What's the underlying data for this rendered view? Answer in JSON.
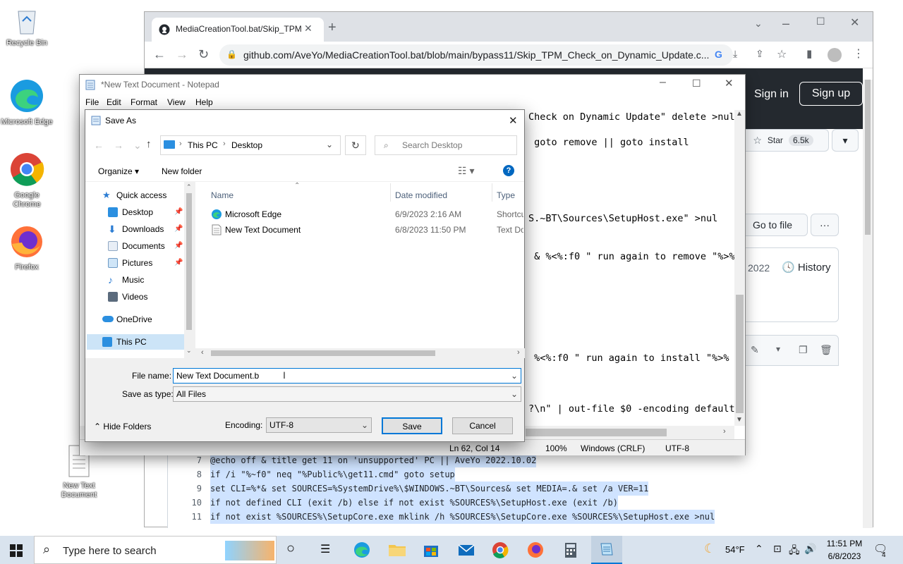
{
  "desktop": {
    "icons": [
      {
        "label": "Recycle Bin"
      },
      {
        "label": "Microsoft Edge"
      },
      {
        "label": "Google Chrome"
      },
      {
        "label": "Firefox"
      },
      {
        "label": "New Text Document"
      }
    ]
  },
  "browser": {
    "tab_title": "MediaCreationTool.bat/Skip_TPM",
    "url": "github.com/AveYo/MediaCreationTool.bat/blob/main/bypass11/Skip_TPM_Check_on_Dynamic_Update.c...",
    "signin": "Sign in",
    "signup": "Sign up",
    "star": "Star",
    "star_count": "6.5k",
    "go_to_file": "Go to file",
    "more": "···",
    "year": "2022",
    "history": "History",
    "code_lines": [
      {
        "n": "7",
        "text": "@echo off & title get 11 on 'unsupported' PC || AveYo 2022.10.02"
      },
      {
        "n": "8",
        "text": "if /i \"%~f0\" neq \"%Public%\\get11.cmd\" goto setup"
      },
      {
        "n": "9",
        "text": "set CLI=%*& set SOURCES=%SystemDrive%\\$WINDOWS.~BT\\Sources& set MEDIA=.& set /a VER=11"
      },
      {
        "n": "10",
        "text": "if not defined CLI (exit /b) else if not exist %SOURCES%\\SetupHost.exe (exit /b)"
      },
      {
        "n": "11",
        "text": "if not exist %SOURCES%\\SetupCore.exe mklink /h %SOURCES%\\SetupCore.exe %SOURCES%\\SetupHost.exe >nul"
      }
    ]
  },
  "notepad": {
    "title": "*New Text Document - Notepad",
    "menu": [
      "File",
      "Edit",
      "Format",
      "View",
      "Help"
    ],
    "visible_lines": [
      "Check on Dynamic Update\" delete >nul",
      " goto remove || goto install",
      "S.~BT\\Sources\\SetupHost.exe\" >nul",
      " & %<%:f0 \" run again to remove \"%>%",
      " %<%:f0 \" run again to install \"%>%",
      "?\\n\" | out-file $0 -encoding default"
    ],
    "status": {
      "position": "Ln 62, Col 14",
      "zoom": "100%",
      "eol": "Windows (CRLF)",
      "encoding": "UTF-8"
    }
  },
  "saveas": {
    "title": "Save As",
    "path": [
      "This PC",
      "Desktop"
    ],
    "search_placeholder": "Search Desktop",
    "organize": "Organize",
    "new_folder": "New folder",
    "nav": [
      {
        "label": "Quick access",
        "icon": "star-icon"
      },
      {
        "label": "Desktop",
        "icon": "desktop-folder-icon",
        "pinned": true
      },
      {
        "label": "Downloads",
        "icon": "download-icon",
        "pinned": true
      },
      {
        "label": "Documents",
        "icon": "documents-icon",
        "pinned": true
      },
      {
        "label": "Pictures",
        "icon": "pictures-icon",
        "pinned": true
      },
      {
        "label": "Music",
        "icon": "music-icon"
      },
      {
        "label": "Videos",
        "icon": "videos-icon"
      },
      {
        "label": "OneDrive",
        "icon": "cloud-icon"
      },
      {
        "label": "This PC",
        "icon": "pc-icon",
        "selected": true
      }
    ],
    "columns": [
      "Name",
      "Date modified",
      "Type"
    ],
    "files": [
      {
        "name": "Microsoft Edge",
        "date": "6/9/2023 2:16 AM",
        "type": "Shortcut"
      },
      {
        "name": "New Text Document",
        "date": "6/8/2023 11:50 PM",
        "type": "Text Doc"
      }
    ],
    "file_name_label": "File name:",
    "file_name": "New Text Document.b",
    "save_type_label": "Save as type:",
    "save_type": "All Files",
    "hide_folders": "Hide Folders",
    "encoding_label": "Encoding:",
    "encoding": "UTF-8",
    "save": "Save",
    "cancel": "Cancel"
  },
  "taskbar": {
    "search_placeholder": "Type here to search",
    "weather": "54°F",
    "time": "11:51 PM",
    "date": "6/8/2023",
    "notifications": "4"
  }
}
